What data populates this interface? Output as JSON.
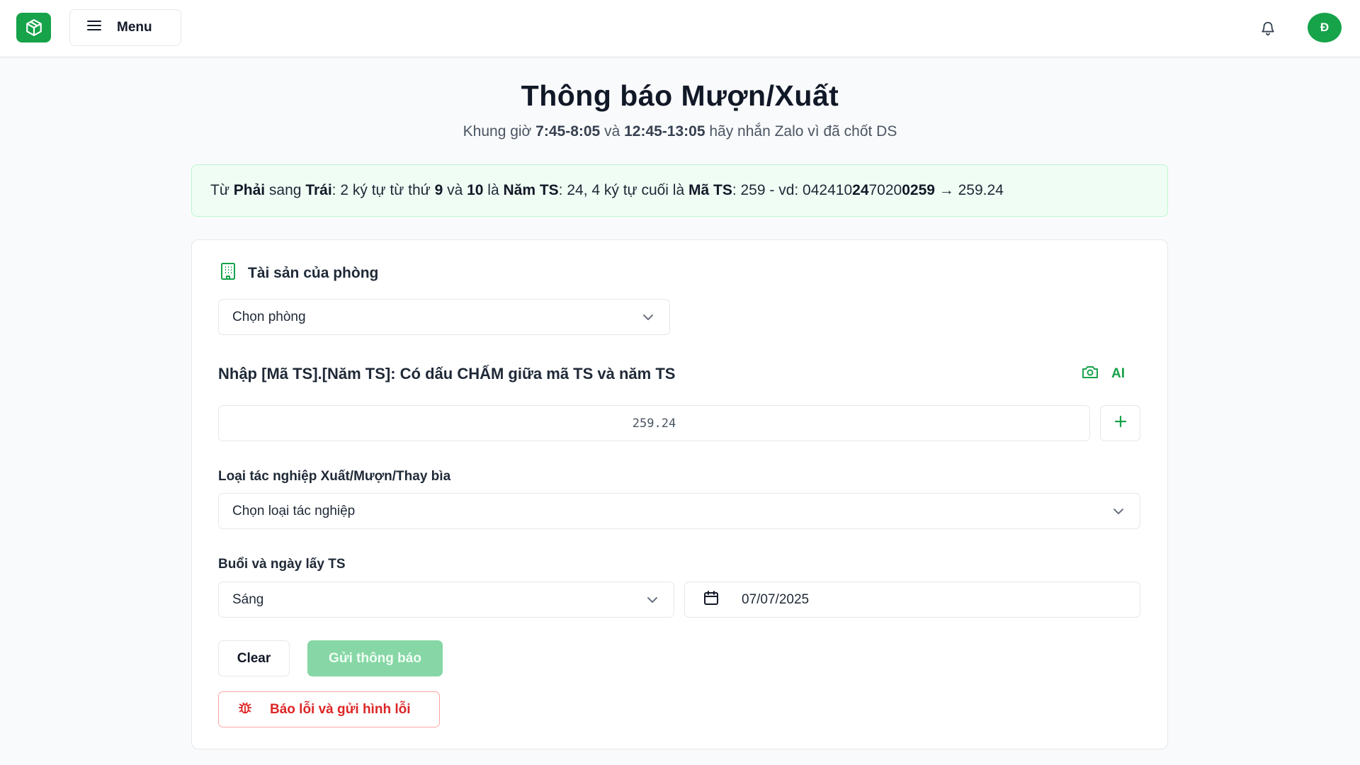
{
  "header": {
    "menu_label": "Menu",
    "avatar_initial": "Đ"
  },
  "page": {
    "title": "Thông báo Mượn/Xuất",
    "subtitle_prefix": "Khung giờ ",
    "subtitle_time1": "7:45-8:05",
    "subtitle_and": " và ",
    "subtitle_time2": "12:45-13:05",
    "subtitle_suffix": " hãy nhắn Zalo vì đã chốt DS"
  },
  "info": {
    "t1": "Từ ",
    "b1": "Phải",
    "t2": " sang ",
    "b2": "Trái",
    "t3": ": 2 ký tự từ thứ ",
    "b3": "9",
    "t4": " và ",
    "b4": "10",
    "t5": " là ",
    "b5": "Năm TS",
    "t6": ": 24, 4 ký tự cuối là ",
    "b6": "Mã TS",
    "t7": ": 259 - vd: 04241",
    "t8": "0",
    "b7": "24",
    "t9": "7020",
    "b8": "0259",
    "t10": " → 259.24"
  },
  "room_section": {
    "title": "Tài sản của phòng",
    "select_value": "Chọn phòng"
  },
  "ts_section": {
    "label": "Nhập [Mã TS].[Năm TS]: Có dấu CHẤM giữa mã TS và năm TS",
    "ai_label": "AI",
    "input_value": "259.24"
  },
  "operation": {
    "label": "Loại tác nghiệp Xuất/Mượn/Thay bìa",
    "select_value": "Chọn loại tác nghiệp"
  },
  "schedule": {
    "label": "Buổi và ngày lấy TS",
    "session_value": "Sáng",
    "date_value": "07/07/2025"
  },
  "actions": {
    "clear_label": "Clear",
    "send_label": "Gửi thông báo",
    "report_label": "Báo lỗi và gửi hình lỗi"
  },
  "colors": {
    "brand": "#16a34a",
    "info_bg": "#f0fdf4",
    "send_disabled": "#86d7a5",
    "danger": "#dc2626"
  },
  "icons": [
    "box-logo-icon",
    "hamburger-icon",
    "bell-icon",
    "building-icon",
    "chevron-down-icon",
    "camera-icon",
    "plus-icon",
    "calendar-icon",
    "bug-icon"
  ]
}
